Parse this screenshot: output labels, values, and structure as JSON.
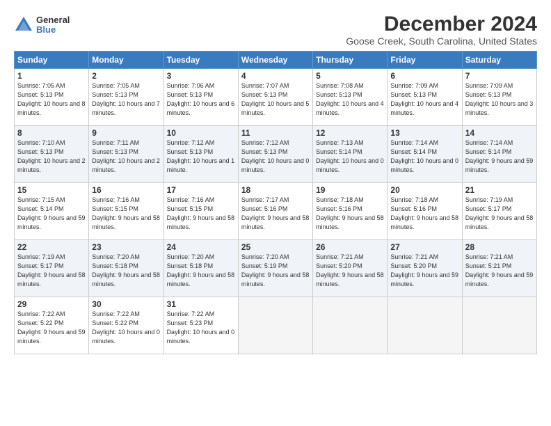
{
  "logo": {
    "general": "General",
    "blue": "Blue"
  },
  "title": "December 2024",
  "location": "Goose Creek, South Carolina, United States",
  "days_header": [
    "Sunday",
    "Monday",
    "Tuesday",
    "Wednesday",
    "Thursday",
    "Friday",
    "Saturday"
  ],
  "weeks": [
    [
      {
        "day": "1",
        "sunrise": "7:05 AM",
        "sunset": "5:13 PM",
        "daylight": "10 hours and 8 minutes."
      },
      {
        "day": "2",
        "sunrise": "7:05 AM",
        "sunset": "5:13 PM",
        "daylight": "10 hours and 7 minutes."
      },
      {
        "day": "3",
        "sunrise": "7:06 AM",
        "sunset": "5:13 PM",
        "daylight": "10 hours and 6 minutes."
      },
      {
        "day": "4",
        "sunrise": "7:07 AM",
        "sunset": "5:13 PM",
        "daylight": "10 hours and 5 minutes."
      },
      {
        "day": "5",
        "sunrise": "7:08 AM",
        "sunset": "5:13 PM",
        "daylight": "10 hours and 4 minutes."
      },
      {
        "day": "6",
        "sunrise": "7:09 AM",
        "sunset": "5:13 PM",
        "daylight": "10 hours and 4 minutes."
      },
      {
        "day": "7",
        "sunrise": "7:09 AM",
        "sunset": "5:13 PM",
        "daylight": "10 hours and 3 minutes."
      }
    ],
    [
      {
        "day": "8",
        "sunrise": "7:10 AM",
        "sunset": "5:13 PM",
        "daylight": "10 hours and 2 minutes."
      },
      {
        "day": "9",
        "sunrise": "7:11 AM",
        "sunset": "5:13 PM",
        "daylight": "10 hours and 2 minutes."
      },
      {
        "day": "10",
        "sunrise": "7:12 AM",
        "sunset": "5:13 PM",
        "daylight": "10 hours and 1 minute."
      },
      {
        "day": "11",
        "sunrise": "7:12 AM",
        "sunset": "5:13 PM",
        "daylight": "10 hours and 0 minutes."
      },
      {
        "day": "12",
        "sunrise": "7:13 AM",
        "sunset": "5:14 PM",
        "daylight": "10 hours and 0 minutes."
      },
      {
        "day": "13",
        "sunrise": "7:14 AM",
        "sunset": "5:14 PM",
        "daylight": "10 hours and 0 minutes."
      },
      {
        "day": "14",
        "sunrise": "7:14 AM",
        "sunset": "5:14 PM",
        "daylight": "9 hours and 59 minutes."
      }
    ],
    [
      {
        "day": "15",
        "sunrise": "7:15 AM",
        "sunset": "5:14 PM",
        "daylight": "9 hours and 59 minutes."
      },
      {
        "day": "16",
        "sunrise": "7:16 AM",
        "sunset": "5:15 PM",
        "daylight": "9 hours and 58 minutes."
      },
      {
        "day": "17",
        "sunrise": "7:16 AM",
        "sunset": "5:15 PM",
        "daylight": "9 hours and 58 minutes."
      },
      {
        "day": "18",
        "sunrise": "7:17 AM",
        "sunset": "5:16 PM",
        "daylight": "9 hours and 58 minutes."
      },
      {
        "day": "19",
        "sunrise": "7:18 AM",
        "sunset": "5:16 PM",
        "daylight": "9 hours and 58 minutes."
      },
      {
        "day": "20",
        "sunrise": "7:18 AM",
        "sunset": "5:16 PM",
        "daylight": "9 hours and 58 minutes."
      },
      {
        "day": "21",
        "sunrise": "7:19 AM",
        "sunset": "5:17 PM",
        "daylight": "9 hours and 58 minutes."
      }
    ],
    [
      {
        "day": "22",
        "sunrise": "7:19 AM",
        "sunset": "5:17 PM",
        "daylight": "9 hours and 58 minutes."
      },
      {
        "day": "23",
        "sunrise": "7:20 AM",
        "sunset": "5:18 PM",
        "daylight": "9 hours and 58 minutes."
      },
      {
        "day": "24",
        "sunrise": "7:20 AM",
        "sunset": "5:18 PM",
        "daylight": "9 hours and 58 minutes."
      },
      {
        "day": "25",
        "sunrise": "7:20 AM",
        "sunset": "5:19 PM",
        "daylight": "9 hours and 58 minutes."
      },
      {
        "day": "26",
        "sunrise": "7:21 AM",
        "sunset": "5:20 PM",
        "daylight": "9 hours and 58 minutes."
      },
      {
        "day": "27",
        "sunrise": "7:21 AM",
        "sunset": "5:20 PM",
        "daylight": "9 hours and 59 minutes."
      },
      {
        "day": "28",
        "sunrise": "7:21 AM",
        "sunset": "5:21 PM",
        "daylight": "9 hours and 59 minutes."
      }
    ],
    [
      {
        "day": "29",
        "sunrise": "7:22 AM",
        "sunset": "5:22 PM",
        "daylight": "9 hours and 59 minutes."
      },
      {
        "day": "30",
        "sunrise": "7:22 AM",
        "sunset": "5:22 PM",
        "daylight": "10 hours and 0 minutes."
      },
      {
        "day": "31",
        "sunrise": "7:22 AM",
        "sunset": "5:23 PM",
        "daylight": "10 hours and 0 minutes."
      },
      null,
      null,
      null,
      null
    ]
  ]
}
